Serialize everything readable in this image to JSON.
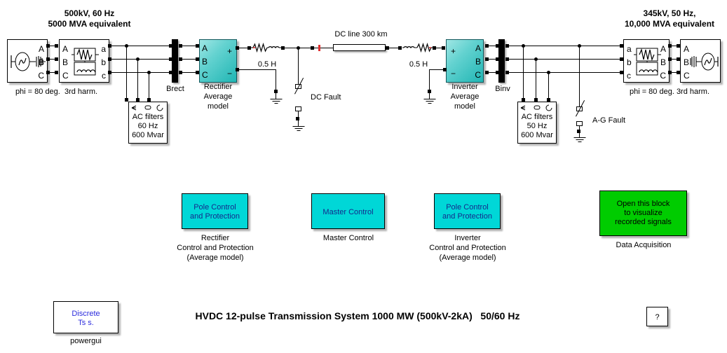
{
  "diagram": {
    "title": "HVDC 12-pulse Transmission System 1000 MW (500kV-2kA)   50/60 Hz",
    "help_label": "?"
  },
  "left_side": {
    "source_caption_line1": "500kV, 60 Hz",
    "source_caption_line2": "5000 MVA equivalent",
    "source_note": "phi = 80 deg.  3rd harm.",
    "source_terminals": [
      "A",
      "B",
      "C"
    ],
    "transformer_in_terminals": [
      "A",
      "B",
      "C"
    ],
    "transformer_out_terminals": [
      "a",
      "b",
      "c"
    ],
    "breaker_label": "Brect",
    "filter": {
      "line1": "AC filters",
      "line2": "60 Hz",
      "line3": "600 Mvar",
      "port_glyphs": [
        "A",
        "B",
        "C"
      ]
    },
    "converter": {
      "ac_terminals": [
        "A",
        "B",
        "C"
      ],
      "dc_plus": "+",
      "dc_minus": "−",
      "caption_line1": "Rectifier",
      "caption_line2": "Average",
      "caption_line3": "model"
    },
    "smoothing_reactor": "0.5 H"
  },
  "dc_link": {
    "line_label": "DC line 300 km",
    "fault_label": "DC Fault"
  },
  "right_side": {
    "source_caption_line1": "345kV, 50 Hz,",
    "source_caption_line2": "10,000 MVA equivalent",
    "source_note": "phi = 80 deg. 3rd harm.",
    "source_terminals": [
      "A",
      "B",
      "C"
    ],
    "transformer_in_terminals": [
      "a",
      "b",
      "c"
    ],
    "transformer_out_terminals": [
      "A",
      "B",
      "C"
    ],
    "breaker_label": "Binv",
    "filter": {
      "line1": "AC filters",
      "line2": "50 Hz",
      "line3": "600 Mvar",
      "port_glyphs": [
        "A",
        "B",
        "C"
      ]
    },
    "converter": {
      "ac_terminals": [
        "A",
        "B",
        "C"
      ],
      "dc_plus": "+",
      "dc_minus": "−",
      "caption_line1": "Inverter",
      "caption_line2": "Average",
      "caption_line3": "model"
    },
    "smoothing_reactor": "0.5 H",
    "fault_label": "A-G Fault"
  },
  "controls": [
    {
      "block_line1": "Pole Control",
      "block_line2": "and Protection",
      "caption_line1": "Rectifier",
      "caption_line2": "Control and Protection",
      "caption_line3": "(Average model)"
    },
    {
      "block_line1": "Master Control",
      "block_line2": "",
      "caption_line1": "Master Control",
      "caption_line2": "",
      "caption_line3": ""
    },
    {
      "block_line1": "Pole Control",
      "block_line2": "and Protection",
      "caption_line1": "Inverter",
      "caption_line2": "Control and Protection",
      "caption_line3": "(Average model)"
    }
  ],
  "data_acquisition": {
    "block_line1": "Open this block",
    "block_line2": "to visualize",
    "block_line3": "recorded signals",
    "caption": "Data Acquisition"
  },
  "powergui": {
    "block_line1": "Discrete",
    "block_line2": "Ts s.",
    "caption": "powergui"
  },
  "colors": {
    "converter_teal": "#21b6b4",
    "control_cyan": "#00d7d7",
    "acquisition_green": "#00cc00",
    "powergui_text": "#2b2bdd",
    "control_text": "#142a8c",
    "fault_marker_red": "#e03030"
  }
}
